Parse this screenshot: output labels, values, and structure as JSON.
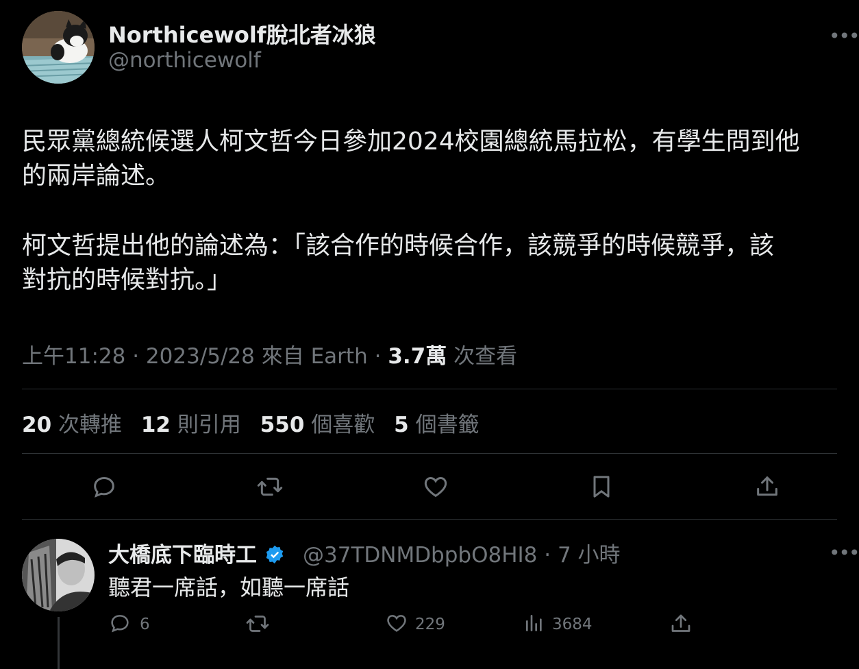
{
  "tweet": {
    "author_name": "Northicewolf脫北者冰狼",
    "author_handle": "@northicewolf",
    "lines": [
      "民眾黨總統候選人柯文哲今日參加2024校園總統馬拉松，有學生問到他",
      "的兩岸論述。",
      "柯文哲提出他的論述為：「該合作的時候合作，該競爭的時候競爭，該",
      "對抗的時候對抗。」"
    ],
    "meta": {
      "time": "上午11:28",
      "date": "2023/5/28",
      "source": "來自 Earth",
      "views_value": "3.7萬",
      "views_label": "次查看"
    },
    "stats": [
      {
        "value": "20",
        "label": "次轉推"
      },
      {
        "value": "12",
        "label": "則引用"
      },
      {
        "value": "550",
        "label": "個喜歡"
      },
      {
        "value": "5",
        "label": "個書籤"
      }
    ],
    "more_icon": "•••"
  },
  "reply": {
    "author_name": "大橋底下臨時工",
    "author_handle": "@37TDNMDbpbO8HI8",
    "time": "· 7 小時",
    "text": "聽君一席話，如聽一席話",
    "counts": {
      "replies": "6",
      "likes": "229",
      "views": "3684"
    },
    "verified_color": "#1d9bf0"
  },
  "icons": [
    "reply-icon",
    "retweet-icon",
    "like-icon",
    "bookmark-icon",
    "share-icon",
    "views-icon",
    "more-icon",
    "verified-badge-icon"
  ]
}
